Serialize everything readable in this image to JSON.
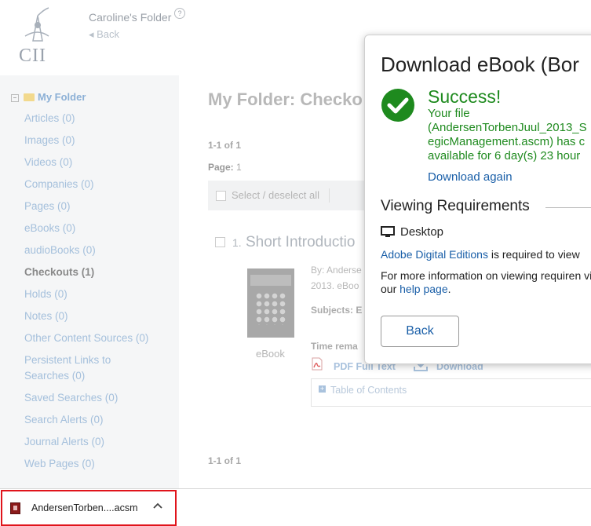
{
  "header": {
    "logo_text": "CII",
    "folder_title": "Caroline's Folder",
    "help": "?",
    "back": "Back"
  },
  "sidebar": {
    "root": "My Folder",
    "items": [
      {
        "label": "Articles (0)"
      },
      {
        "label": "Images (0)"
      },
      {
        "label": "Videos (0)"
      },
      {
        "label": "Companies (0)"
      },
      {
        "label": "Pages (0)"
      },
      {
        "label": "eBooks (0)"
      },
      {
        "label": "audioBooks (0)"
      },
      {
        "label": "Checkouts (1)",
        "active": true
      },
      {
        "label": "Holds (0)"
      },
      {
        "label": "Notes (0)"
      },
      {
        "label": "Other Content Sources (0)"
      },
      {
        "label": "Persistent Links to"
      },
      {
        "label": "Searches (0)"
      },
      {
        "label": "Saved Searches (0)"
      },
      {
        "label": "Search Alerts (0)"
      },
      {
        "label": "Journal Alerts (0)"
      },
      {
        "label": "Web Pages (0)"
      }
    ]
  },
  "main": {
    "title": "My Folder: Checko",
    "range_top": "1-1 of 1",
    "page_label": "Page:",
    "page_value": "1",
    "select_all": "Select / deselect all",
    "item": {
      "number": "1.",
      "title": "Short Introductio",
      "by": "By: Anderse",
      "pub": "2013. eBoo",
      "subjects": "Subjects: E",
      "type": "eBook",
      "time_remaining": "Time rema",
      "pdf_link": "PDF Full Text",
      "download_link": "Download",
      "toc": "Table of Contents"
    },
    "range_bottom": "1-1 of 1"
  },
  "modal": {
    "title": "Download eBook (Bor",
    "success_title": "Success!",
    "success_message": "Your file (AndersenTorbenJuul_2013_S egicManagement.ascm) has c available for 6 day(s) 23 hour",
    "download_again": "Download again",
    "requirements_title": "Viewing Requirements",
    "desktop": "Desktop",
    "ade_link": "Adobe Digital Editions",
    "ade_text": " is required to view",
    "info_text": "For more information on viewing requiren visit our ",
    "help_link": "help page",
    "info_end": ".",
    "back_button": "Back",
    "success_color": "#1e8a1e"
  },
  "download_bar": {
    "file_name": "AndersenTorben....acsm",
    "highlight_color": "#e0141b"
  }
}
